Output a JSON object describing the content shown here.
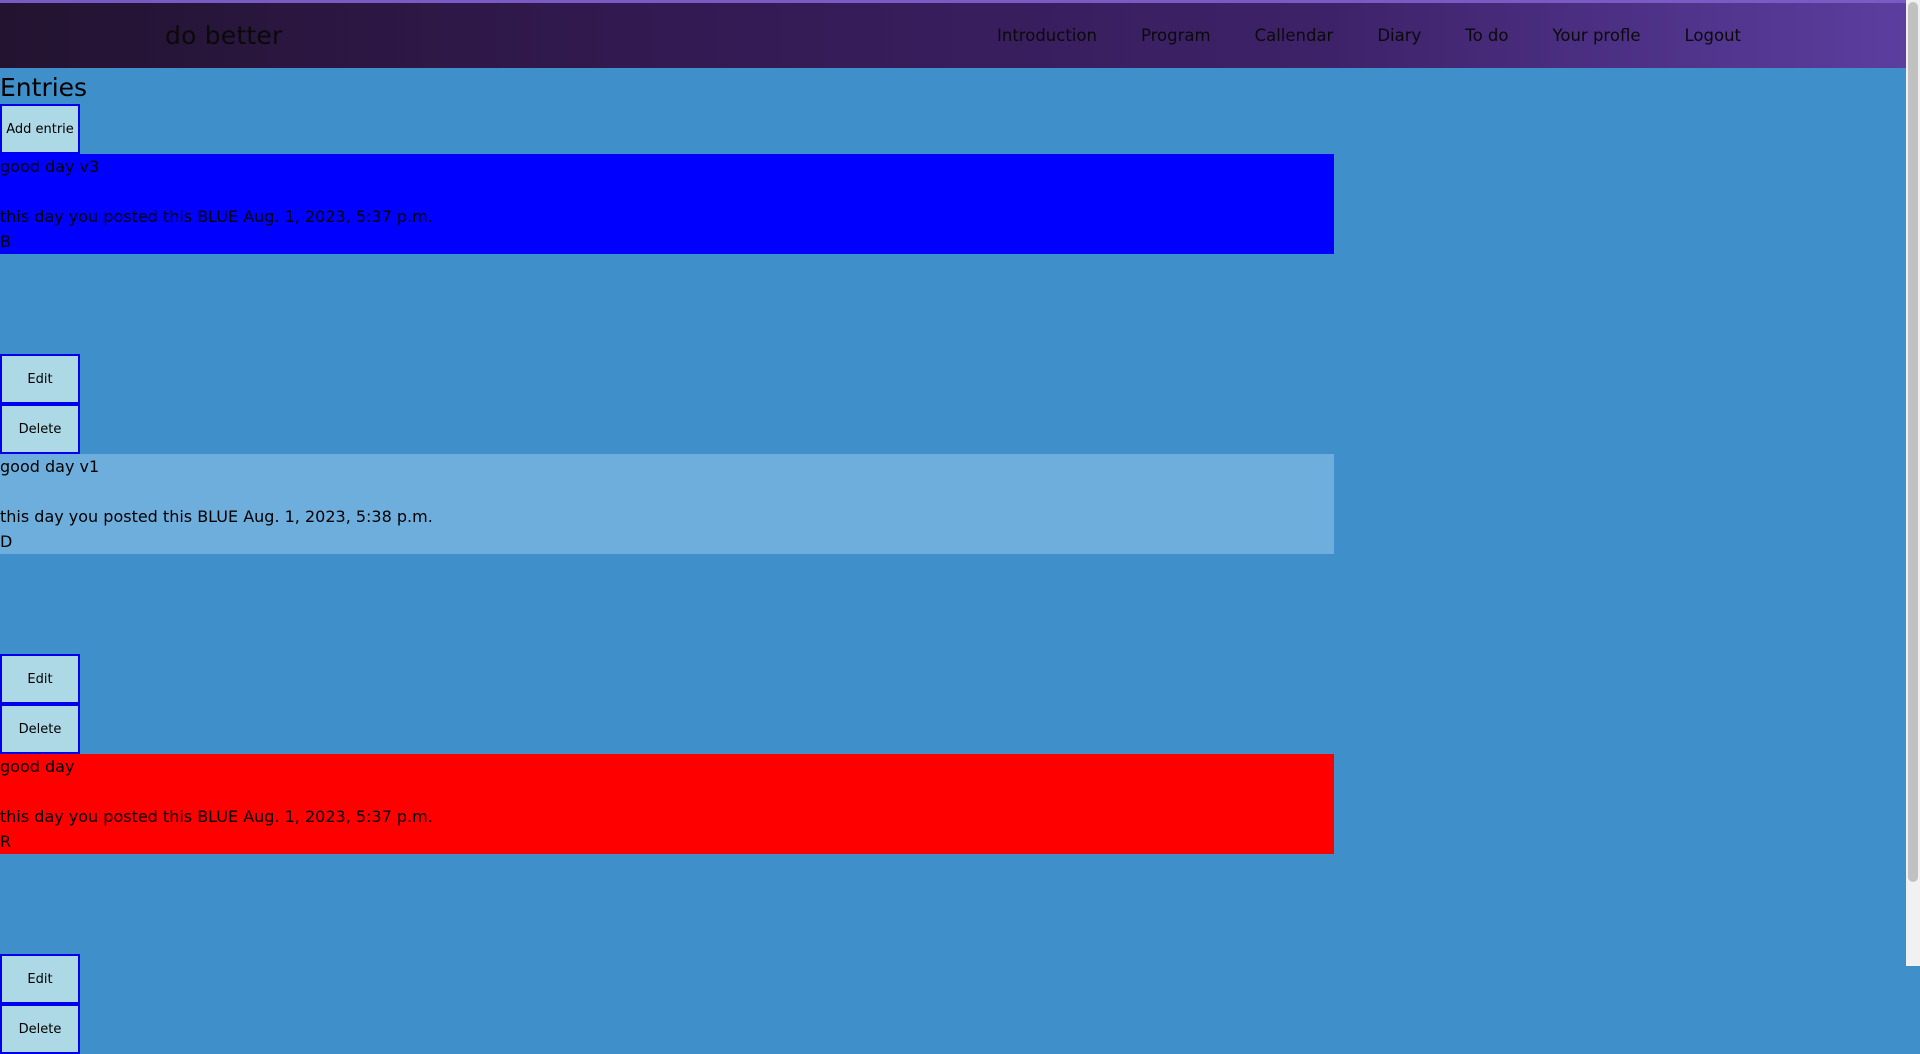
{
  "app": {
    "brand": "do better"
  },
  "nav": {
    "items": [
      "Introduction",
      "Program",
      "Callendar",
      "Diary",
      "To do",
      "Your profle",
      "Logout"
    ]
  },
  "page": {
    "title": "Entries",
    "add_label": "Add entrie"
  },
  "entries": [
    {
      "title": "good day v3",
      "meta": "this day you posted this BLUE Aug. 1, 2023, 5:37 p.m.",
      "letter": "B",
      "color": "#0000ff",
      "edit_label": "Edit",
      "delete_label": "Delete"
    },
    {
      "title": "good day v1",
      "meta": "this day you posted this BLUE Aug. 1, 2023, 5:38 p.m.",
      "letter": "D",
      "color": "#6eaedd",
      "edit_label": "Edit",
      "delete_label": "Delete"
    },
    {
      "title": "good day",
      "meta": "this day you posted this BLUE Aug. 1, 2023, 5:37 p.m.",
      "letter": "R",
      "color": "#ff0000",
      "edit_label": "Edit",
      "delete_label": "Delete"
    }
  ],
  "colors": {
    "page_background": "#3f8fca",
    "button_background": "#add8e6",
    "button_border": "#0000ee"
  }
}
